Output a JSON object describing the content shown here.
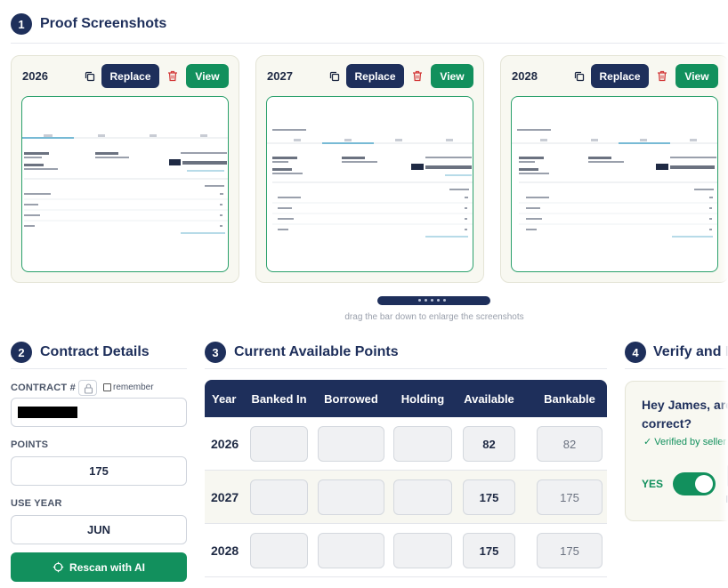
{
  "sections": {
    "proof": {
      "num": "1",
      "title": "Proof Screenshots"
    },
    "contract": {
      "num": "2",
      "title": "Contract Details"
    },
    "points": {
      "num": "3",
      "title": "Current Available Points"
    },
    "verify": {
      "num": "4",
      "title": "Verify and Lo"
    }
  },
  "screenshots": {
    "cards": [
      {
        "year": "2026",
        "replace_label": "Replace",
        "view_label": "View"
      },
      {
        "year": "2027",
        "replace_label": "Replace",
        "view_label": "View"
      },
      {
        "year": "2028",
        "replace_label": "Replace",
        "view_label": "View"
      }
    ],
    "hint": "drag the bar down to enlarge the screenshots"
  },
  "contract": {
    "contract_label": "CONTRACT #",
    "remember_label": "remember",
    "points_label": "POINTS",
    "points_value": "175",
    "use_year_label": "USE YEAR",
    "use_year_value": "JUN",
    "rescan_label": "Rescan with AI"
  },
  "points_table": {
    "headers": [
      "Year",
      "Banked In",
      "Borrowed",
      "Holding",
      "Available",
      "Bankable"
    ],
    "rows": [
      {
        "year": "2026",
        "banked_in": "",
        "borrowed": "",
        "holding": "",
        "available": "82",
        "bankable": "82"
      },
      {
        "year": "2027",
        "banked_in": "",
        "borrowed": "",
        "holding": "",
        "available": "175",
        "bankable": "175"
      },
      {
        "year": "2028",
        "banked_in": "",
        "borrowed": "",
        "holding": "",
        "available": "175",
        "bankable": "175"
      }
    ]
  },
  "verify": {
    "question": "Hey James, are correct?",
    "verified": "Verified by seller",
    "yes_label": "YES",
    "toggle_on": true
  },
  "colors": {
    "navy": "#1e2f5b",
    "green": "#12905d"
  }
}
